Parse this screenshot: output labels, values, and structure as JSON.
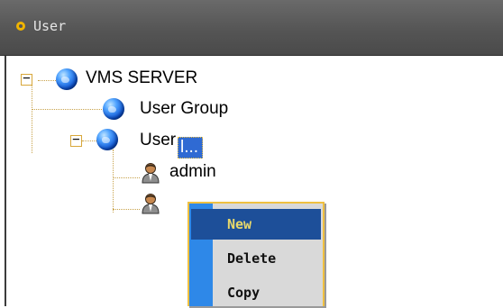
{
  "panel": {
    "title": "User"
  },
  "tree": {
    "root": {
      "label": "VMS SERVER",
      "toggle": "−"
    },
    "user_group": {
      "label": "User Group"
    },
    "user": {
      "label": "User",
      "toggle": "−"
    },
    "admin": {
      "label": "admin"
    },
    "selected_user": {
      "label": "l..."
    }
  },
  "context_menu": {
    "items": [
      {
        "label": "New",
        "highlighted": true
      },
      {
        "label": "Delete",
        "highlighted": false
      },
      {
        "label": "Copy",
        "highlighted": false
      }
    ],
    "gutter_color": "#2e88e8",
    "highlight_color": "#1d4f99"
  },
  "icons": {
    "node": "globe-icon",
    "user": "user-icon",
    "title": "circle-icon"
  }
}
